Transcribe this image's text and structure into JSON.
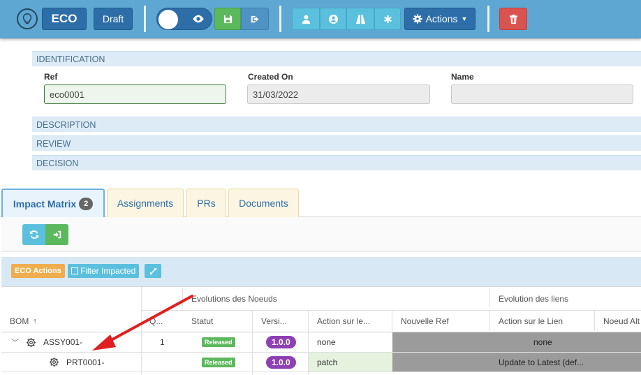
{
  "toolbar": {
    "logo_icon": "lightbulb-icon",
    "eco_label": "ECO",
    "draft_label": "Draft",
    "actions_label": "Actions",
    "icons": [
      "eye-icon",
      "save-icon",
      "sign-out-icon",
      "user-icon",
      "user-circle-icon",
      "road-icon",
      "asterisk-icon",
      "gear-icon",
      "trash-icon"
    ]
  },
  "sections": {
    "identification": "IDENTIFICATION",
    "description": "DESCRIPTION",
    "review": "REVIEW",
    "decision": "DECISION"
  },
  "form": {
    "ref_label": "Ref",
    "ref_value": "eco0001",
    "created_label": "Created On",
    "created_value": "31/03/2022",
    "name_label": "Name",
    "name_value": ""
  },
  "tabs": [
    {
      "label": "Impact Matrix",
      "badge": "2"
    },
    {
      "label": "Assignments"
    },
    {
      "label": "PRs"
    },
    {
      "label": "Documents"
    }
  ],
  "actions_bar": {
    "eco_actions": "ECO Actions",
    "filter_impacted": "Filter Impacted"
  },
  "grid": {
    "group_nodes": "Evolutions des Noeuds",
    "group_links": "Evolution des liens",
    "headers": {
      "bom": "BOM",
      "sort_icon": "arrow-up-icon",
      "qty": "Q...",
      "statut": "Statut",
      "version": "Versi...",
      "action": "Action sur le...",
      "nouvelle_ref": "Nouvelle Ref",
      "action_lien": "Action sur le Lien",
      "noeud_alt": "Noeud Alt"
    },
    "rows": [
      {
        "bom": "ASSY001-",
        "qty": "1",
        "statut": "Released",
        "version": "1.0.0",
        "action": "none",
        "action_lien": "none"
      },
      {
        "bom": "PRT0001-",
        "qty": "",
        "statut": "Released",
        "version": "1.0.0",
        "action": "patch",
        "action_lien": "Update to Latest (def..."
      }
    ]
  },
  "colors": {
    "toolbar": "#5ea7d3",
    "primary": "#2d6ea8",
    "success": "#5cb85c",
    "info": "#5bc0de",
    "danger": "#d9534f",
    "warning": "#f0ad4e",
    "version": "#8e3fb1",
    "arrow": "#e02020"
  }
}
